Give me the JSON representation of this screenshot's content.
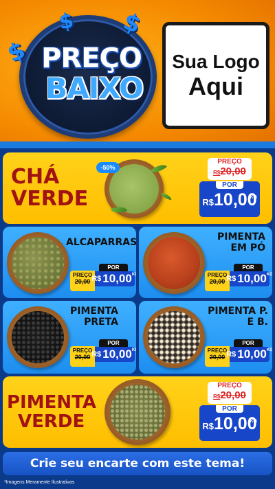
{
  "header": {
    "headline_top": "PREÇO",
    "headline_bottom": "BAIXO",
    "currency_symbol": "$",
    "logo_line1": "Sua Logo",
    "logo_line2": "Aqui"
  },
  "featured": [
    {
      "name_line1": "CHÁ",
      "name_line2": "VERDE",
      "discount": "-50%",
      "old_label": "PREÇO",
      "old_currency": "R$",
      "old_value": "20,00",
      "new_label": "POR",
      "new_currency": "R$",
      "new_value": "10,00",
      "unit": "KG"
    },
    {
      "name_line1": "PIMENTA",
      "name_line2": "VERDE",
      "old_label": "PREÇO",
      "old_currency": "R$",
      "old_value": "20,00",
      "new_label": "POR",
      "new_currency": "R$",
      "new_value": "10,00",
      "unit": "KG"
    }
  ],
  "products": [
    {
      "name_line1": "ALCAPARRAS",
      "name_line2": "",
      "old_label": "PREÇO",
      "old_value": "20,00",
      "new_label": "POR",
      "currency": "R$",
      "new_value": "10,00",
      "unit": "KG"
    },
    {
      "name_line1": "PIMENTA",
      "name_line2": "EM PÓ",
      "old_label": "PREÇO",
      "old_value": "20,00",
      "new_label": "POR",
      "currency": "R$",
      "new_value": "10,00",
      "unit": "KG"
    },
    {
      "name_line1": "PIMENTA",
      "name_line2": "PRETA",
      "old_label": "PREÇO",
      "old_value": "20,00",
      "new_label": "POR",
      "currency": "R$",
      "new_value": "10,00",
      "unit": "KG"
    },
    {
      "name_line1": "PIMENTA P.",
      "name_line2": "E B.",
      "old_label": "PREÇO",
      "old_value": "20,00",
      "new_label": "POR",
      "currency": "R$",
      "new_value": "10,00",
      "unit": "KG"
    }
  ],
  "cta": "Crie seu encarte com este tema!",
  "footnote": "*Imagens Meramente Ilustrativas",
  "colors": {
    "header_orange": "#f58a00",
    "card_yellow": "#ffc81a",
    "card_blue": "#2c9bf5",
    "price_blue": "#1846c9",
    "name_red": "#a11212",
    "background_navy": "#0b3a8a"
  }
}
